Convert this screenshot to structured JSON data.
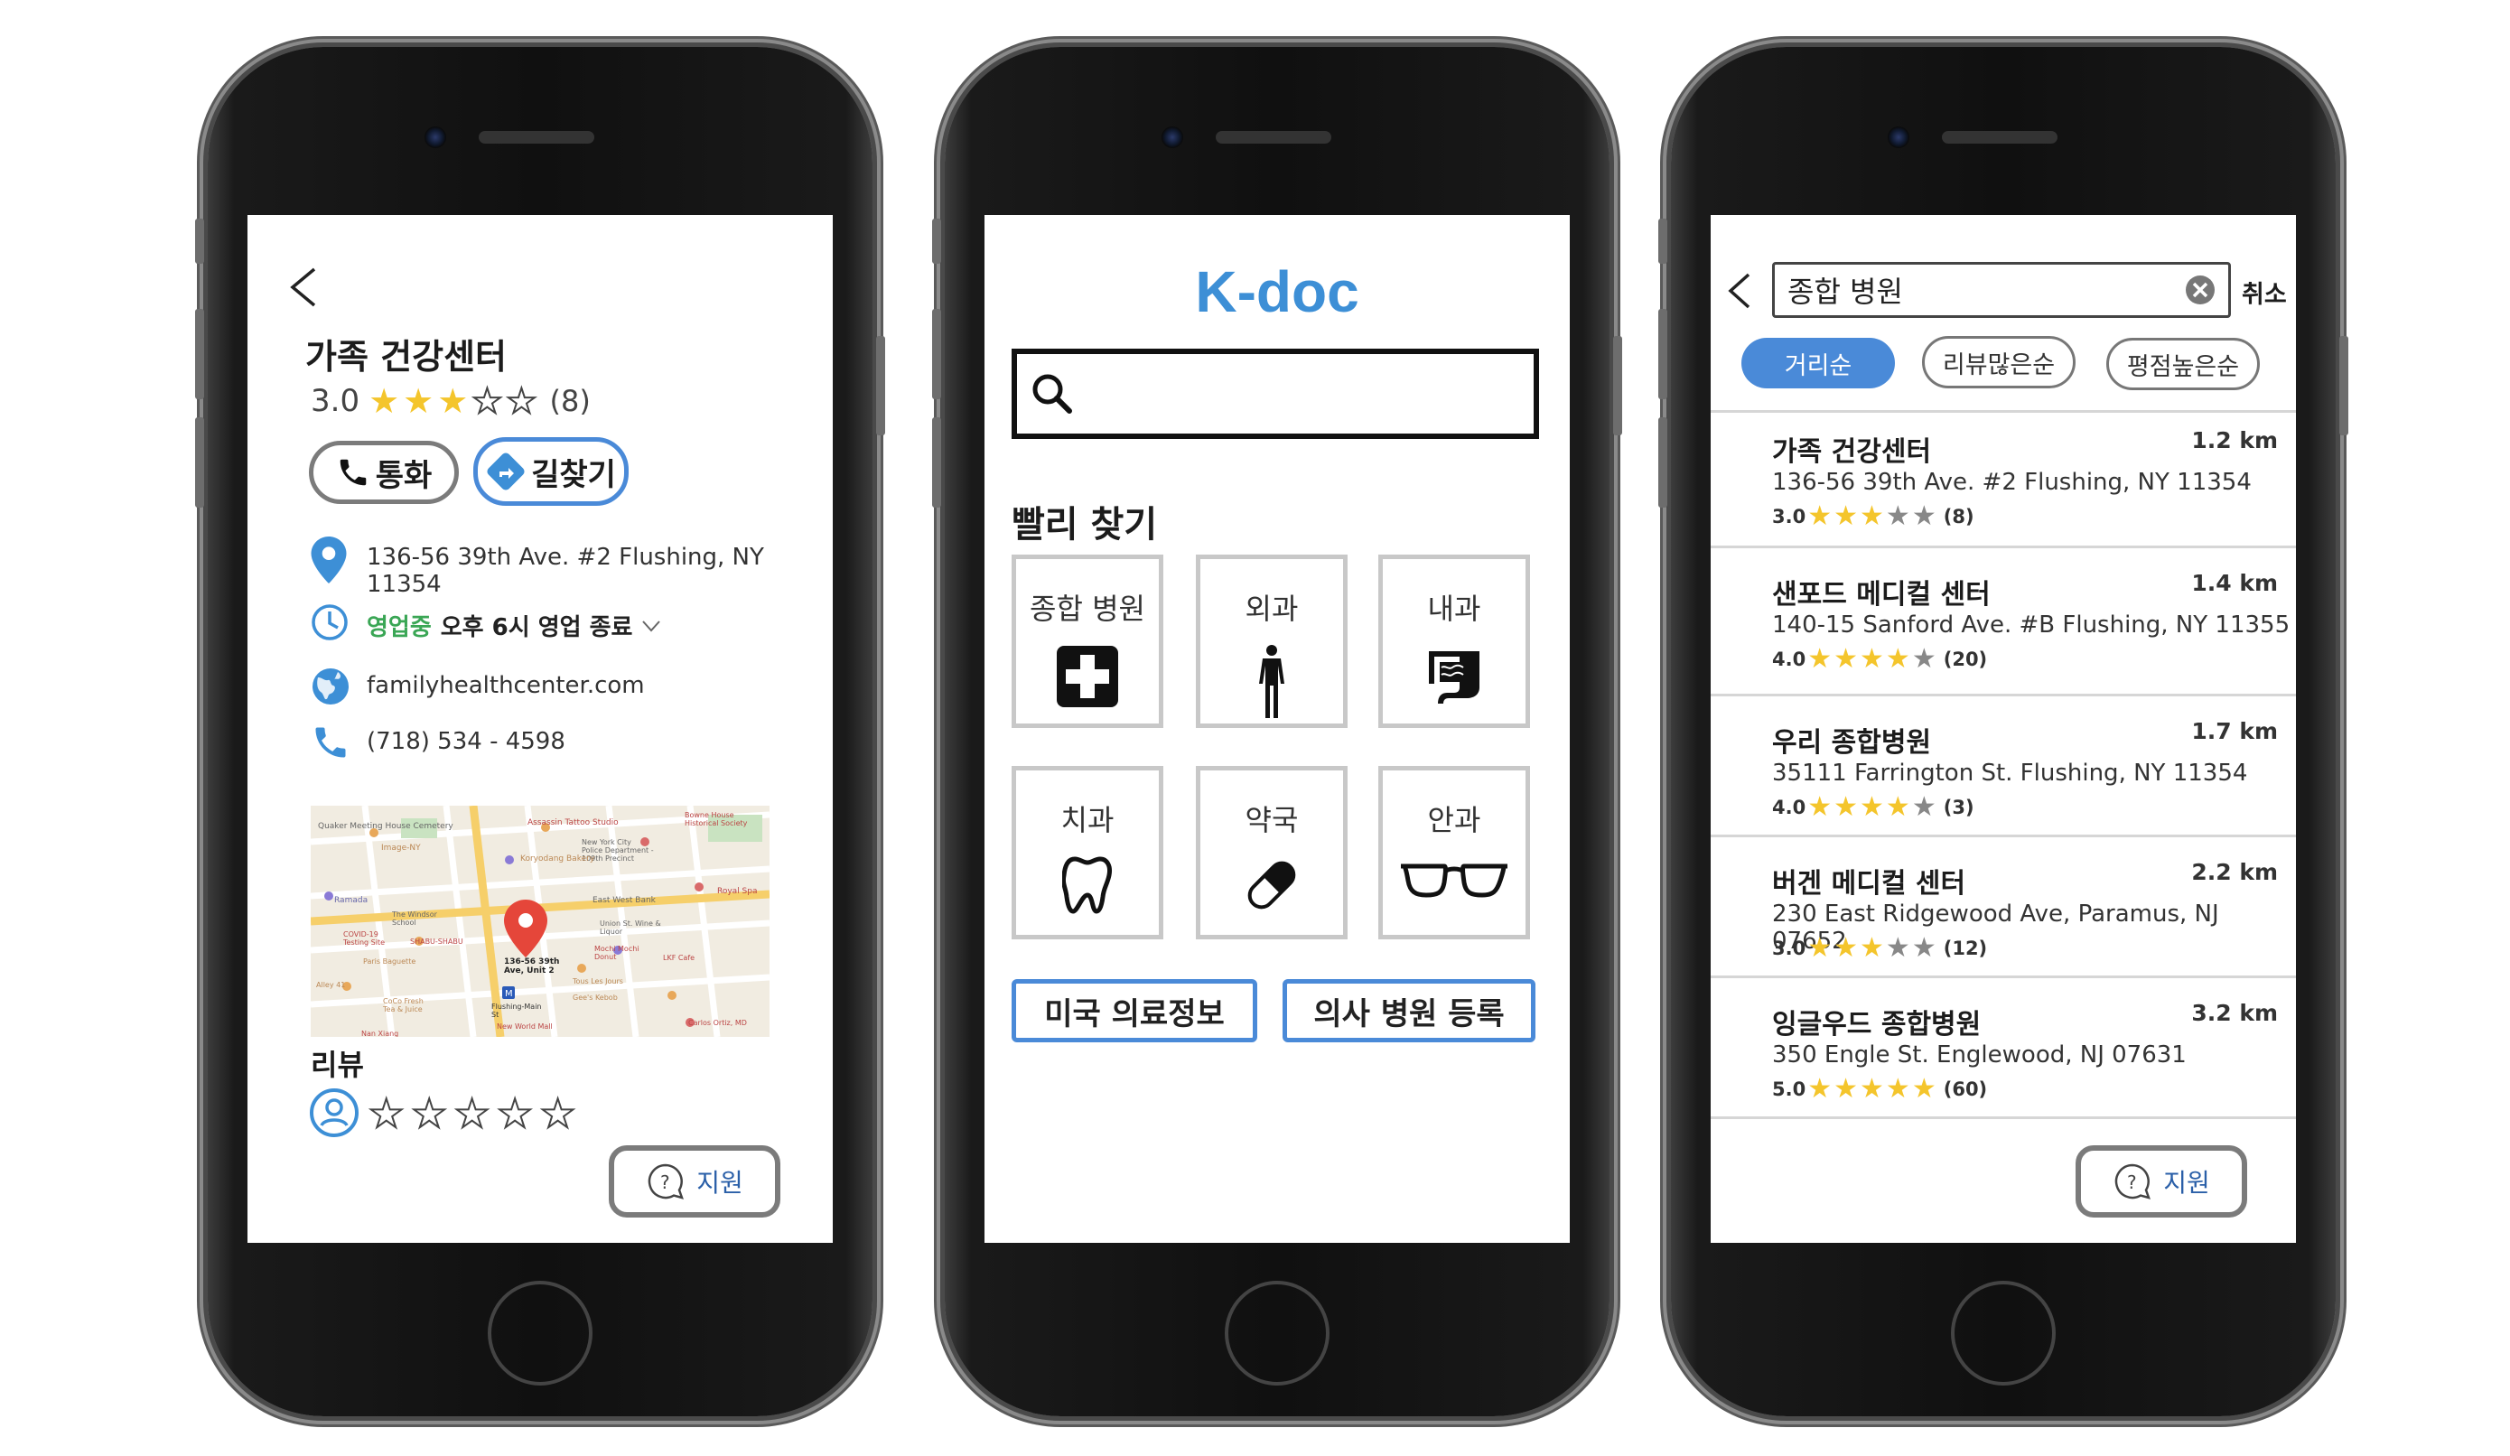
{
  "detail": {
    "title": "가족 건강센터",
    "rating_value": "3.0",
    "rating_stars": 3,
    "rating_count": "(8)",
    "call_label": "통화",
    "directions_label": "길찾기",
    "address": "136-56 39th Ave. #2 Flushing, NY 11354",
    "hours_status": "영업중",
    "hours_detail": "오후 6시 영업 종료",
    "website": "familyhealthcenter.com",
    "phone": "(718) 534 - 4598",
    "map": {
      "pin_label": "136-56 39th Ave, Unit 2",
      "places": [
        "Quaker Meeting House Cemetery",
        "Assassin Tattoo Studio",
        "New York City Police Department - 109th Precinct",
        "Image-NY",
        "Koryodang Bakery",
        "East West Bank",
        "Royal Spa",
        "Ramada",
        "The Windsor School",
        "Union St. Wine & Liquor",
        "COVID-19 Testing Site",
        "SHABU-SHABU",
        "Paris Baguette",
        "Mochi Mochi Donut",
        "LKF Cafe",
        "Tous Les Jours",
        "Alley 41",
        "Gee's Kebob",
        "CoCo Fresh Tea & Juice",
        "Flushing-Main St",
        "New World Mall",
        "Carlos Ortiz, MD",
        "Bowne House Historical Society",
        "Nan Xiang"
      ]
    },
    "review_heading": "리뷰",
    "support_label": "지원"
  },
  "home": {
    "brand": "K-doc",
    "search_placeholder": "",
    "quick_heading": "빨리 찾기",
    "categories": [
      {
        "label": "종합 병원",
        "icon": "hospital-cross-icon"
      },
      {
        "label": "외과",
        "icon": "human-body-icon"
      },
      {
        "label": "내과",
        "icon": "intestine-icon"
      },
      {
        "label": "치과",
        "icon": "tooth-icon"
      },
      {
        "label": "약국",
        "icon": "pill-icon"
      },
      {
        "label": "안과",
        "icon": "glasses-icon"
      }
    ],
    "button_info": "미국 의료정보",
    "button_register": "의사 병원 등록"
  },
  "results": {
    "search_query": "종합 병원",
    "cancel_label": "취소",
    "sort_options": [
      "거리순",
      "리뷰많은순",
      "평점높은순"
    ],
    "active_sort": "거리순",
    "items": [
      {
        "name": "가족 건강센터",
        "distance": "1.2 km",
        "address": "136-56 39th Ave. #2 Flushing, NY 11354",
        "rating": "3.0",
        "stars": 3,
        "count": "(8)"
      },
      {
        "name": "샌포드 메디컬 센터",
        "distance": "1.4 km",
        "address": "140-15 Sanford Ave. #B Flushing, NY 11355",
        "rating": "4.0",
        "stars": 4,
        "count": "(20)"
      },
      {
        "name": "우리 종합병원",
        "distance": "1.7 km",
        "address": "35111 Farrington St. Flushing, NY 11354",
        "rating": "4.0",
        "stars": 4,
        "count": "(3)"
      },
      {
        "name": "버겐 메디컬 센터",
        "distance": "2.2 km",
        "address": "230 East Ridgewood Ave, Paramus, NJ 07652",
        "rating": "3.0",
        "stars": 3,
        "count": "(12)"
      },
      {
        "name": "잉글우드 종합병원",
        "distance": "3.2 km",
        "address": "350 Engle St. Englewood, NJ 07631",
        "rating": "5.0",
        "stars": 5,
        "count": "(60)"
      }
    ],
    "support_label": "지원"
  },
  "colors": {
    "accent_blue": "#4a8ad8",
    "brand_blue": "#3d8fd6",
    "open_green": "#3aa655",
    "star_yellow": "#f4c52c"
  }
}
